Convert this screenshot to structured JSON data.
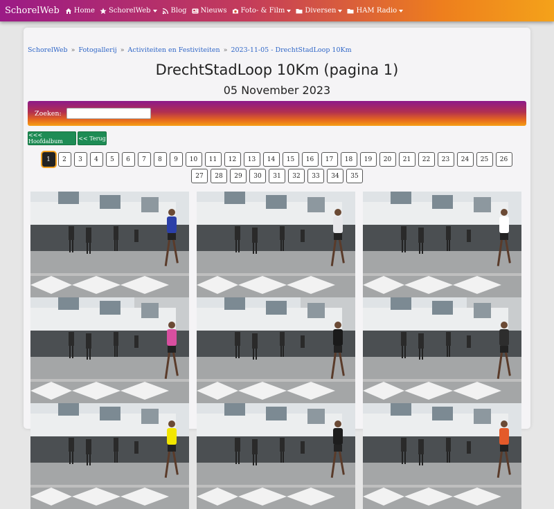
{
  "navbar": {
    "brand": "SchorelWeb",
    "items": [
      {
        "label": "Home",
        "icon": "home-icon",
        "dropdown": false
      },
      {
        "label": "SchorelWeb",
        "icon": "star-icon",
        "dropdown": true
      },
      {
        "label": "Blog",
        "icon": "rss-icon",
        "dropdown": false
      },
      {
        "label": "Nieuws",
        "icon": "newspaper-icon",
        "dropdown": false
      },
      {
        "label": "Foto- & Film",
        "icon": "camera-icon",
        "dropdown": true
      },
      {
        "label": "Diversen",
        "icon": "folder-icon",
        "dropdown": true
      },
      {
        "label": "HAM Radio",
        "icon": "folder-icon",
        "dropdown": true
      }
    ]
  },
  "breadcrumb": [
    "SchorelWeb",
    "Fotogallerij",
    "Activiteiten en Festiviteiten",
    "2023-11-05 - DrechtStadLoop 10Km"
  ],
  "page": {
    "title": "DrechtStadLoop 10Km (pagina 1)",
    "date": "05 November 2023"
  },
  "search": {
    "label": "Zoeken:",
    "value": "",
    "placeholder": ""
  },
  "buttons": {
    "main_album": "<<< Hoofdalbum",
    "back": "<< Terug"
  },
  "pagination": {
    "current": 1,
    "pages": [
      "1",
      "2",
      "3",
      "4",
      "5",
      "6",
      "7",
      "8",
      "9",
      "10",
      "11",
      "12",
      "13",
      "14",
      "15",
      "16",
      "17",
      "18",
      "19",
      "20",
      "21",
      "22",
      "23",
      "24",
      "25",
      "26",
      "27",
      "28",
      "29",
      "30",
      "31",
      "32",
      "33",
      "34",
      "35"
    ]
  },
  "gallery": {
    "items": [
      "photo",
      "photo",
      "photo",
      "photo",
      "photo",
      "photo",
      "photo",
      "photo",
      "photo"
    ]
  },
  "colors": {
    "green_button": "#1e8c55",
    "link": "#2f66c7",
    "nav_gradient_start": "#9b1a86",
    "nav_gradient_end": "#f4a21a"
  }
}
